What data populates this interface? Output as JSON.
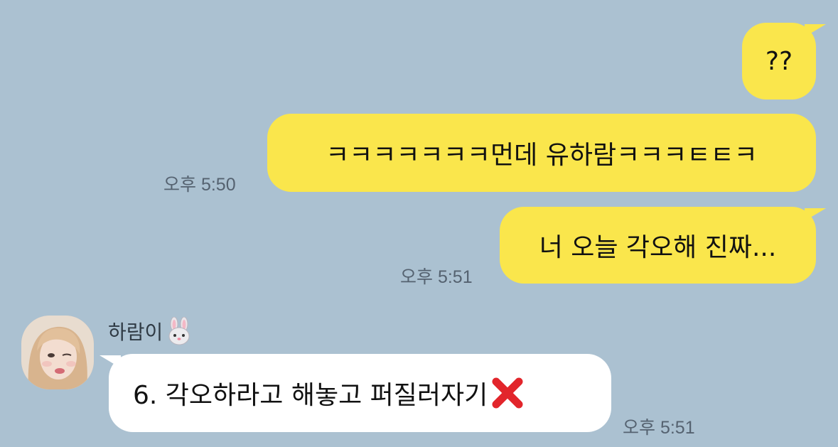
{
  "messages": [
    {
      "id": "m1",
      "text": "??",
      "time": ""
    },
    {
      "id": "m2",
      "text": "ㅋㅋㅋㅋㅋㅋㅋ먼데 유하람ㅋㅋㅋㅌㅌㅋ",
      "time": "오후 5:50"
    },
    {
      "id": "m3",
      "text": "너 오늘 각오해 진짜...",
      "time": "오후 5:51"
    }
  ],
  "reply": {
    "sender_name": "하람이",
    "sender_emoji": "rabbit-face-icon",
    "text": "6. 각오하라고 해놓고 퍼질러자기",
    "trailing_emoji": "cross-mark-icon",
    "time": "오후 5:51"
  },
  "colors": {
    "background": "#abc1d1",
    "my_bubble": "#fae64c",
    "their_bubble": "#ffffff",
    "cross_mark": "#e2252b"
  }
}
